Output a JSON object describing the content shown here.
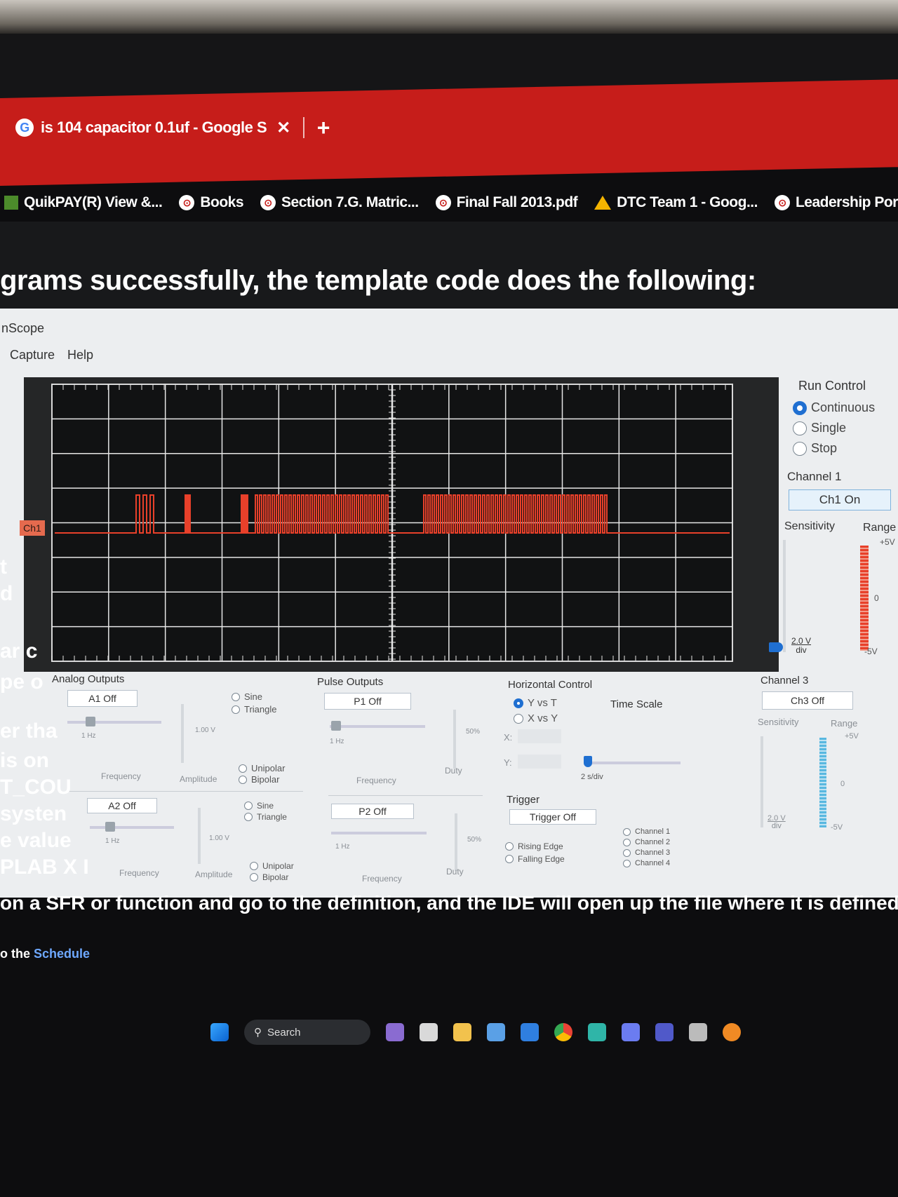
{
  "browser": {
    "tab_title": "is 104 capacitor 0.1uf - Google S",
    "close_glyph": "✕",
    "new_tab_glyph": "+",
    "bookmarks": [
      "QuikPAY(R) View &...",
      "Books",
      "Section 7.G. Matric...",
      "Final Fall 2013.pdf",
      "DTC Team 1 - Goog...",
      "Leadership Portal"
    ]
  },
  "page": {
    "heading": "grams successfully, the template code does the following:",
    "left_fragments": [
      "t",
      "d",
      "ar c",
      "pe o",
      "er tha",
      "is on",
      "T_COU",
      "systen",
      "e value",
      "PLAB X I"
    ],
    "bottom_line": "on a SFR or function and go to the definition, and the IDE will open up the file where it is defined.",
    "schedule_prefix": "o the ",
    "schedule_link": "Schedule"
  },
  "app": {
    "title": "nScope",
    "menu": [
      "Capture",
      "Help"
    ],
    "ch1_marker": "Ch1",
    "run_control": {
      "title": "Run Control",
      "options": [
        "Continuous",
        "Single",
        "Stop"
      ],
      "selected": "Continuous"
    },
    "channel1": {
      "title": "Channel 1",
      "button": "Ch1 On",
      "sensitivity_label": "Sensitivity",
      "range_label": "Range",
      "sensitivity_value": "2.0 V",
      "sensitivity_unit": "div",
      "range_top": "+5V",
      "range_mid": "0",
      "range_bottom": "-5V",
      "color": "#e8402a"
    },
    "channel3": {
      "title": "Channel 3",
      "button": "Ch3 Off",
      "sensitivity_label": "Sensitivity",
      "range_label": "Range",
      "sensitivity_value": "2.0 V",
      "sensitivity_unit": "div",
      "range_top": "+5V",
      "range_mid": "0",
      "range_bottom": "-5V",
      "color": "#59b8e0"
    },
    "analog_outputs": {
      "title": "Analog Outputs",
      "a1": {
        "button": "A1 Off",
        "freq_value": "1 Hz",
        "amp_value": "1.00 V",
        "wave": [
          "Sine",
          "Triangle"
        ],
        "polarity": [
          "Unipolar",
          "Bipolar"
        ],
        "freq_label": "Frequency",
        "amp_label": "Amplitude"
      },
      "a2": {
        "button": "A2 Off",
        "freq_value": "1 Hz",
        "amp_value": "1.00 V",
        "wave": [
          "Sine",
          "Triangle"
        ],
        "polarity": [
          "Unipolar",
          "Bipolar"
        ],
        "freq_label": "Frequency",
        "amp_label": "Amplitude"
      }
    },
    "pulse_outputs": {
      "title": "Pulse Outputs",
      "p1": {
        "button": "P1 Off",
        "freq_value": "1 Hz",
        "duty_value": "50%",
        "freq_label": "Frequency",
        "duty_label": "Duty"
      },
      "p2": {
        "button": "P2 Off",
        "freq_value": "1 Hz",
        "duty_value": "50%",
        "freq_label": "Frequency",
        "duty_label": "Duty"
      }
    },
    "horizontal": {
      "title": "Horizontal Control",
      "modes": [
        "Y vs T",
        "X vs Y"
      ],
      "selected": "Y vs T",
      "x_label": "X:",
      "y_label": "Y:",
      "time_scale_label": "Time Scale",
      "time_scale_value": "2 s/div"
    },
    "trigger": {
      "title": "Trigger",
      "button": "Trigger Off",
      "edges": [
        "Rising Edge",
        "Falling Edge"
      ],
      "channels": [
        "Channel 1",
        "Channel 2",
        "Channel 3",
        "Channel 4"
      ]
    }
  },
  "taskbar": {
    "search": "Search"
  }
}
